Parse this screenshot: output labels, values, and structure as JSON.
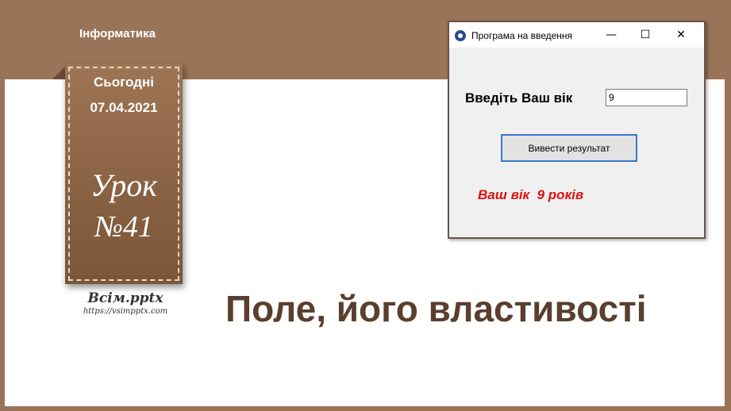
{
  "subject": "Інформатика",
  "ribbon": {
    "today_label": "Сьогодні",
    "date": "07.04.2021",
    "lesson_label": "Урок",
    "lesson_number": "№41"
  },
  "logo": {
    "name": "Всім.pptx",
    "url": "https://vsimpptx.com"
  },
  "slide_title": "Поле, його властивості",
  "app_window": {
    "title": "Програма на введення",
    "controls": {
      "minimize": "—",
      "maximize": "☐",
      "close": "✕"
    },
    "age_label": "Введіть Ваш вік",
    "age_value": "9",
    "button_label": "Вивести результат",
    "result_text": "Ваш вік  9 років"
  },
  "colors": {
    "background_brown": "#9a7458",
    "title_brown": "#5a3e2e",
    "result_red": "#e01010",
    "button_border_blue": "#3b7ac8"
  }
}
